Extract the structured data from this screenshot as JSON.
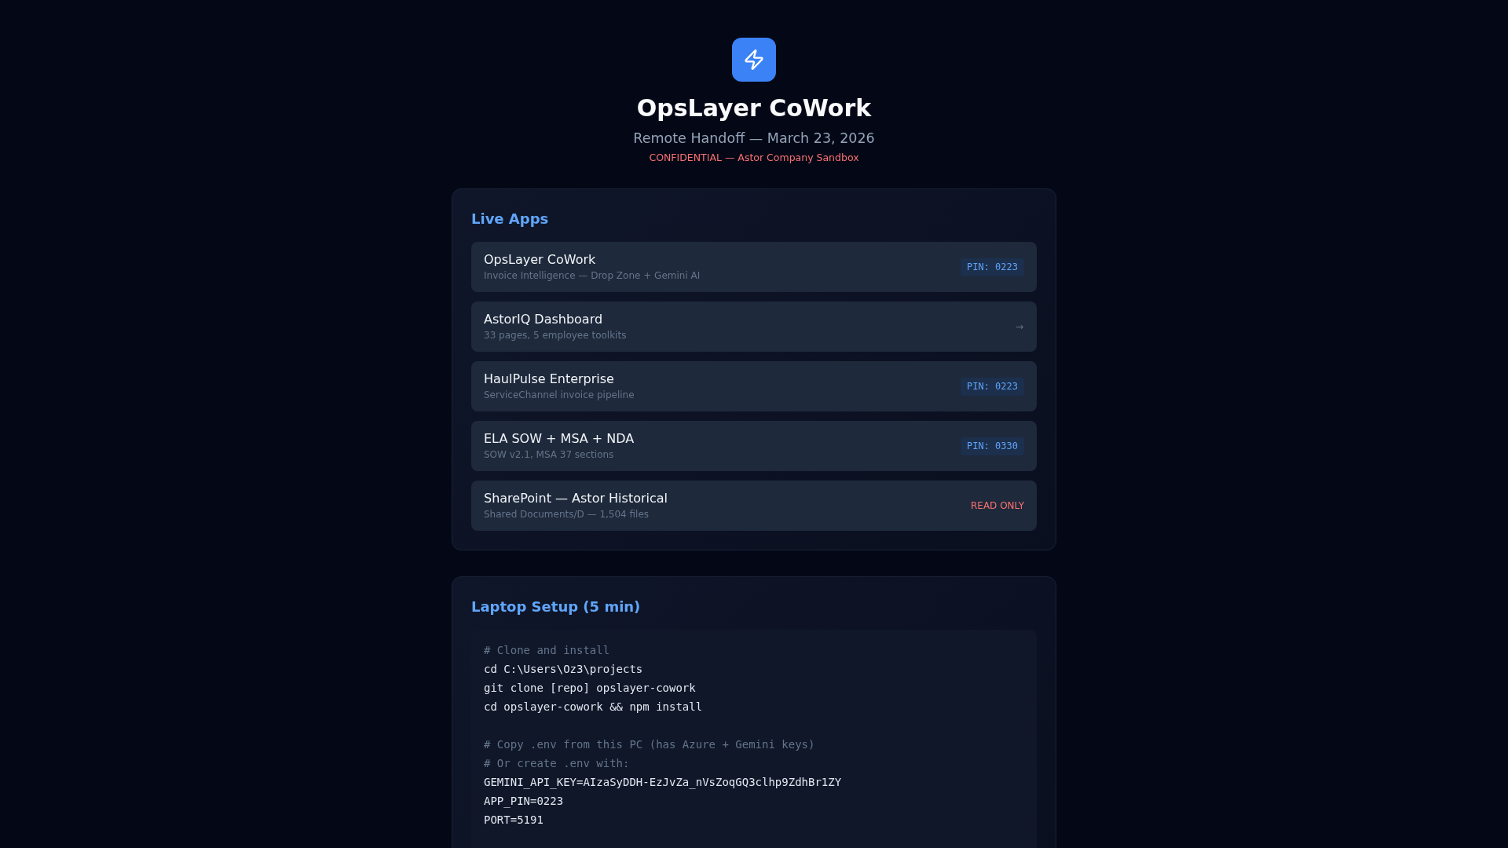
{
  "header": {
    "title": "OpsLayer CoWork",
    "subtitle": "Remote Handoff — March 23, 2026",
    "notice": "CONFIDENTIAL — Astor Company Sandbox"
  },
  "sections": [
    {
      "kind": "apps",
      "title": "Live Apps",
      "apps": [
        {
          "name": "OpsLayer CoWork",
          "description": "Invoice Intelligence — Drop Zone + Gemini AI",
          "tag": {
            "kind": "pin",
            "text": "PIN: 0223"
          }
        },
        {
          "name": "AstorIQ Dashboard",
          "description": "33 pages, 5 employee toolkits",
          "tag": {
            "kind": "arrow",
            "text": "→"
          }
        },
        {
          "name": "HaulPulse Enterprise",
          "description": "ServiceChannel invoice pipeline",
          "tag": {
            "kind": "pin",
            "text": "PIN: 0223"
          }
        },
        {
          "name": "ELA SOW + MSA + NDA",
          "description": "SOW v2.1, MSA 37 sections",
          "tag": {
            "kind": "pin",
            "text": "PIN: 0330"
          }
        },
        {
          "name": "SharePoint — Astor Historical",
          "description": "Shared Documents/D — 1,504 files",
          "tag": {
            "kind": "status",
            "text": "READ ONLY"
          }
        }
      ]
    },
    {
      "kind": "code",
      "title": "Laptop Setup (5 min)",
      "blocks": [
        {
          "lines": [
            {
              "kind": "comment",
              "text": "# Clone and install"
            },
            {
              "kind": "command",
              "text": "cd C:\\Users\\Oz3\\projects"
            },
            {
              "kind": "command",
              "text": "git clone [repo] opslayer-cowork"
            },
            {
              "kind": "command",
              "text": "cd opslayer-cowork && npm install"
            }
          ]
        },
        {
          "lines": [
            {
              "kind": "comment",
              "text": "# Copy .env from this PC (has Azure + Gemini keys)"
            },
            {
              "kind": "comment",
              "text": "# Or create .env with:"
            },
            {
              "kind": "command",
              "text": "GEMINI_API_KEY=AIzaSyDDH-EzJvZa_nVsZoqGQ3clhp9ZdhBr1ZY"
            },
            {
              "kind": "command",
              "text": "APP_PIN=0223"
            },
            {
              "kind": "command",
              "text": "PORT=5191"
            }
          ]
        }
      ]
    }
  ]
}
